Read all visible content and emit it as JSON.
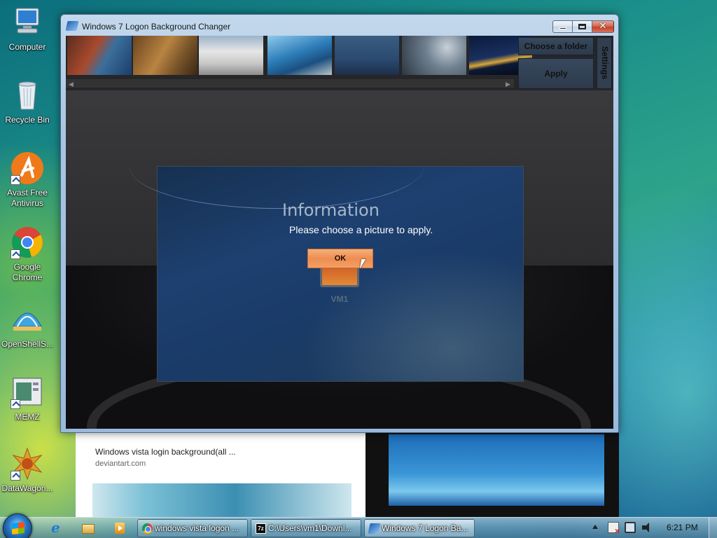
{
  "desktop": {
    "icons": [
      {
        "label": "Computer"
      },
      {
        "label": "Recycle Bin"
      },
      {
        "label": "Avast Free Antivirus"
      },
      {
        "label": "Google Chrome"
      },
      {
        "label": "OpenShellS..."
      },
      {
        "label": "MEMZ"
      },
      {
        "label": "DataWagon..."
      }
    ]
  },
  "browser_background": {
    "result_title": "Windows vista login background(all ...",
    "result_source": "deviantart.com"
  },
  "window": {
    "title": "Windows 7 Logon Background Changer",
    "buttons": {
      "choose_folder": "Choose a folder",
      "apply": "Apply",
      "settings": "Settings"
    },
    "preview": {
      "username": "VM1"
    },
    "dialog": {
      "title": "Information",
      "message": "Please choose a picture to apply.",
      "ok": "OK"
    }
  },
  "taskbar": {
    "tasks": [
      {
        "label": "windows vista logon ...",
        "icon": "chrome-icon"
      },
      {
        "label": "C:\\Users\\vm1\\Downl...",
        "icon": "7zip-icon"
      },
      {
        "label": "Windows 7 Logon Ba...",
        "icon": "w7-logon-icon",
        "active": true
      }
    ],
    "clock": "6:21 PM"
  }
}
